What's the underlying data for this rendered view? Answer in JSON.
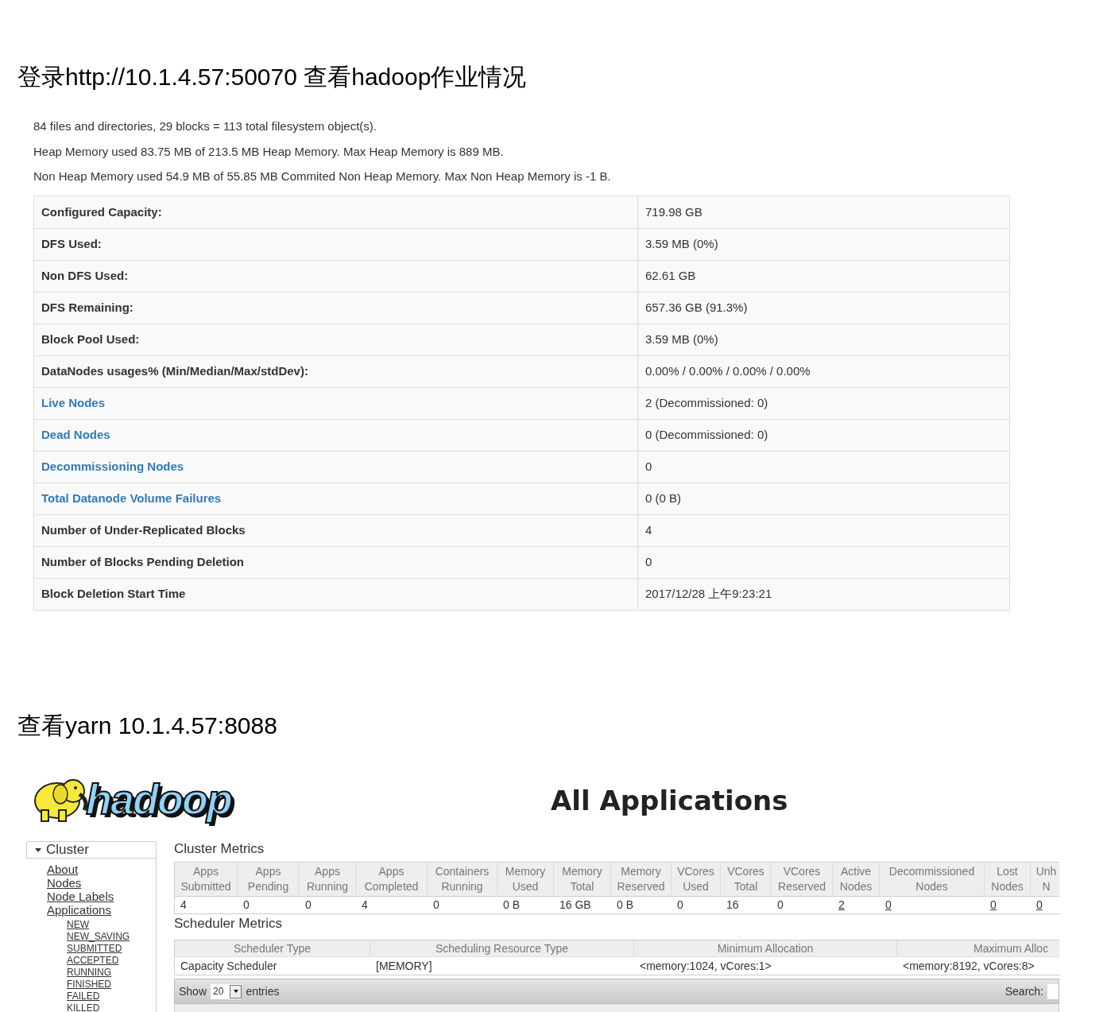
{
  "heading_hdfs": "登录http://10.1.4.57:50070 查看hadoop作业情况",
  "hdfs": {
    "summary_lines": [
      "84 files and directories, 29 blocks = 113 total filesystem object(s).",
      "Heap Memory used 83.75 MB of 213.5 MB Heap Memory. Max Heap Memory is 889 MB.",
      "Non Heap Memory used 54.9 MB of 55.85 MB Commited Non Heap Memory. Max Non Heap Memory is -1 B."
    ],
    "rows": [
      {
        "label": "Configured Capacity:",
        "value": "719.98 GB",
        "link": false
      },
      {
        "label": "DFS Used:",
        "value": "3.59 MB (0%)",
        "link": false
      },
      {
        "label": "Non DFS Used:",
        "value": "62.61 GB",
        "link": false
      },
      {
        "label": "DFS Remaining:",
        "value": "657.36 GB (91.3%)",
        "link": false
      },
      {
        "label": "Block Pool Used:",
        "value": "3.59 MB (0%)",
        "link": false
      },
      {
        "label": "DataNodes usages% (Min/Median/Max/stdDev):",
        "value": "0.00% / 0.00% / 0.00% / 0.00%",
        "link": false
      },
      {
        "label": "Live Nodes",
        "value": "2 (Decommissioned: 0)",
        "link": true
      },
      {
        "label": "Dead Nodes",
        "value": "0 (Decommissioned: 0)",
        "link": true
      },
      {
        "label": "Decommissioning Nodes",
        "value": "0",
        "link": true
      },
      {
        "label": "Total Datanode Volume Failures",
        "value": "0 (0 B)",
        "link": true
      },
      {
        "label": "Number of Under-Replicated Blocks",
        "value": "4",
        "link": false
      },
      {
        "label": "Number of Blocks Pending Deletion",
        "value": "0",
        "link": false
      },
      {
        "label": "Block Deletion Start Time",
        "value": "2017/12/28 上午9:23:21",
        "link": false
      }
    ]
  },
  "heading_yarn": "查看yarn 10.1.4.57:8088",
  "yarn": {
    "logo_text": "hadoop",
    "title": "All Applications",
    "sidebar": {
      "section": "Cluster",
      "expanded": true,
      "items": [
        {
          "label": "About"
        },
        {
          "label": "Nodes"
        },
        {
          "label": "Node Labels"
        },
        {
          "label": "Applications",
          "children": [
            {
              "label": "NEW"
            },
            {
              "label": "NEW_SAVING"
            },
            {
              "label": "SUBMITTED"
            },
            {
              "label": "ACCEPTED"
            },
            {
              "label": "RUNNING"
            },
            {
              "label": "FINISHED"
            },
            {
              "label": "FAILED"
            },
            {
              "label": "KILLED"
            }
          ]
        }
      ]
    },
    "cluster_metrics": {
      "title": "Cluster Metrics",
      "columns": [
        "Apps Submitted",
        "Apps Pending",
        "Apps Running",
        "Apps Completed",
        "Containers Running",
        "Memory Used",
        "Memory Total",
        "Memory Reserved",
        "VCores Used",
        "VCores Total",
        "VCores Reserved",
        "Active Nodes",
        "Decommissioned Nodes",
        "Lost Nodes",
        "Unh N"
      ],
      "cells": [
        {
          "text": "4",
          "link": false
        },
        {
          "text": "0",
          "link": false
        },
        {
          "text": "0",
          "link": false
        },
        {
          "text": "4",
          "link": false
        },
        {
          "text": "0",
          "link": false
        },
        {
          "text": "0 B",
          "link": false
        },
        {
          "text": "16 GB",
          "link": false
        },
        {
          "text": "0 B",
          "link": false
        },
        {
          "text": "0",
          "link": false
        },
        {
          "text": "16",
          "link": false
        },
        {
          "text": "0",
          "link": false
        },
        {
          "text": "2",
          "link": true
        },
        {
          "text": "0",
          "link": true
        },
        {
          "text": "0",
          "link": true
        },
        {
          "text": "0",
          "link": true
        }
      ]
    },
    "scheduler_metrics": {
      "title": "Scheduler Metrics",
      "columns": [
        "Scheduler Type",
        "Scheduling Resource Type",
        "Minimum Allocation",
        "Maximum Alloc"
      ],
      "row": [
        "Capacity Scheduler",
        "[MEMORY]",
        "<memory:1024, vCores:1>",
        "<memory:8192, vCores:8>"
      ]
    },
    "entries_bar": {
      "show_label": "Show",
      "page_size": "20",
      "entries_label": "entries",
      "search_label": "Search:"
    }
  }
}
